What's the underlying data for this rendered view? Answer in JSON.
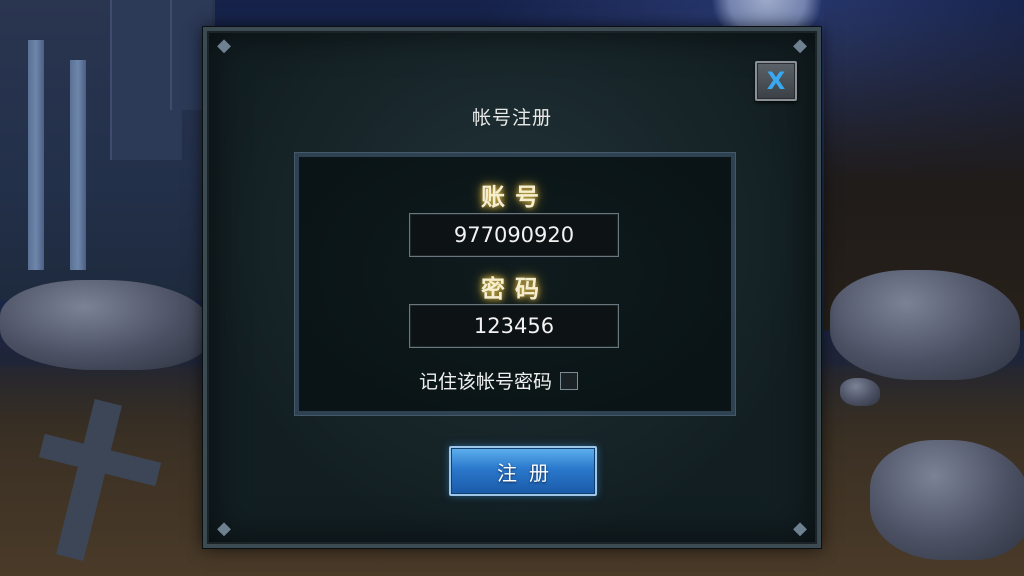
{
  "dialog": {
    "title": "帐号注册",
    "close_label": "X"
  },
  "form": {
    "account_label": "账号",
    "account_value": "977090920",
    "password_label": "密码",
    "password_value": "123456",
    "remember_label": "记住该帐号密码",
    "remember_checked": false
  },
  "register_button_label": "注册",
  "icons": [
    "close-icon",
    "checkbox-icon"
  ],
  "colors": {
    "accent_blue": "#2a78cc",
    "label_glow": "#d8b84a",
    "close_x": "#3aa8f0"
  }
}
